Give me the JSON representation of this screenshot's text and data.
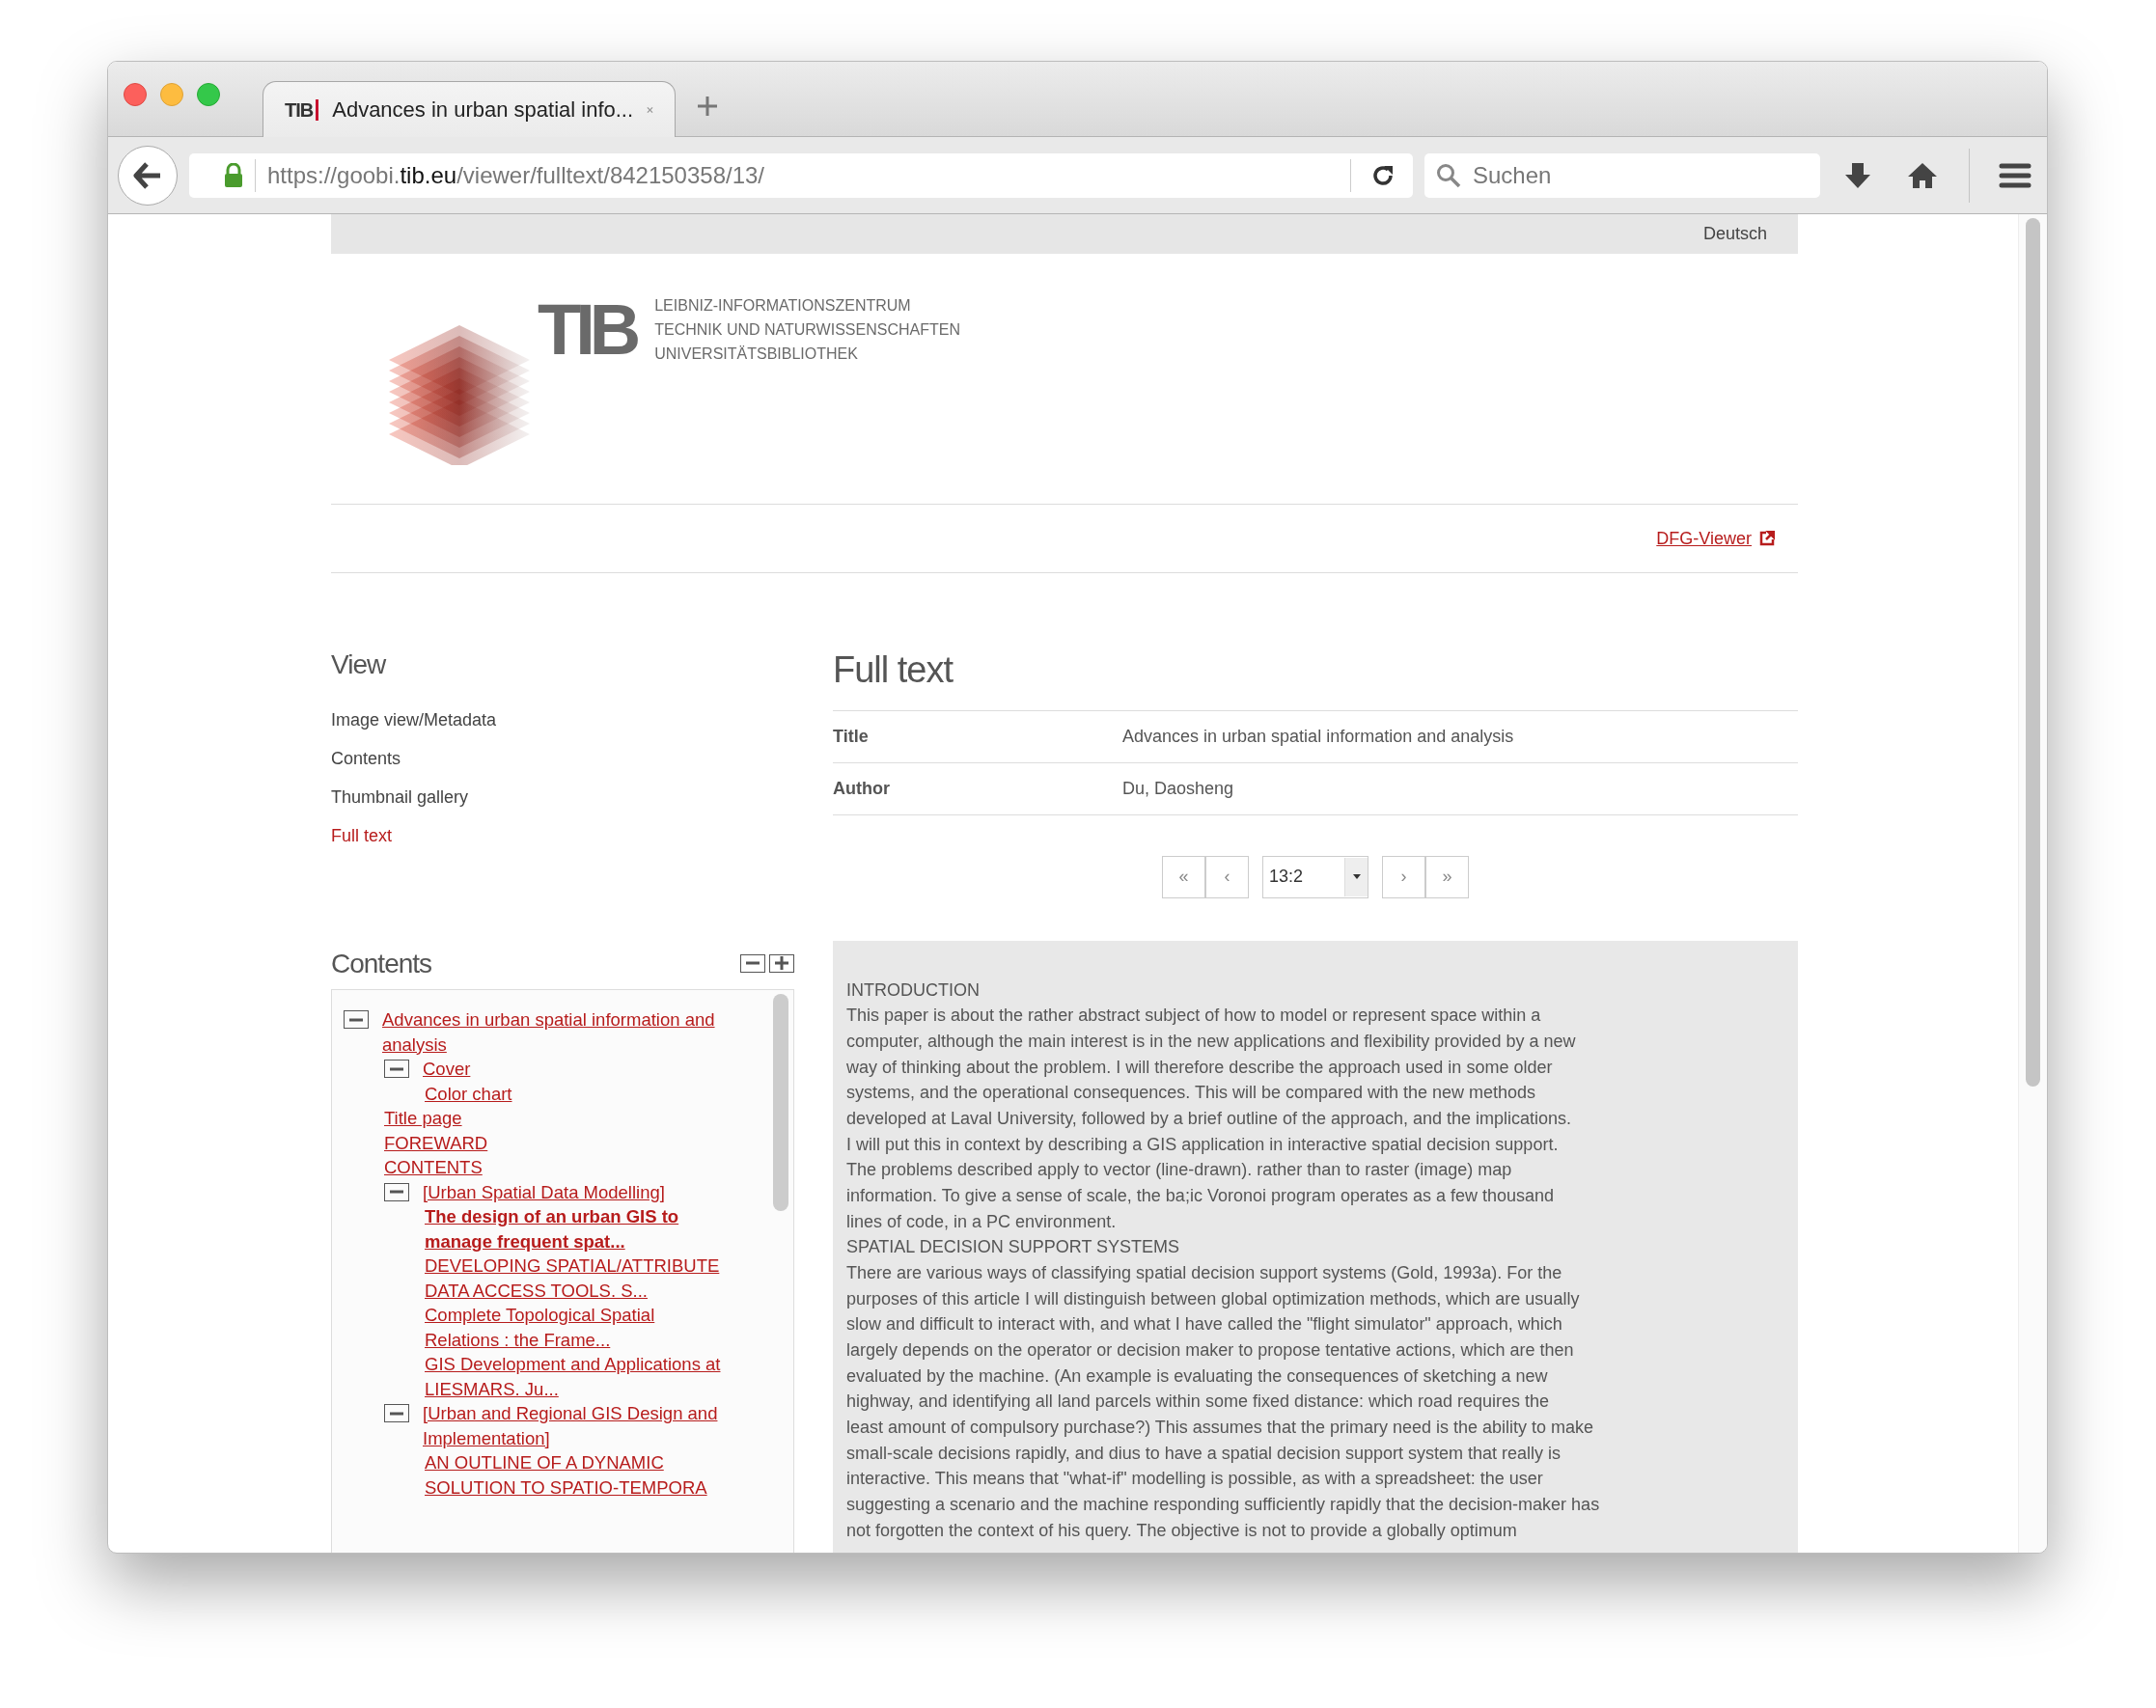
{
  "browser": {
    "tabs": [
      {
        "favicon": "TIB",
        "title": "Advances in urban spatial info...",
        "selected": true
      }
    ],
    "address": {
      "before": "https://goobi.",
      "domain": "tib.eu",
      "after": "/viewer/fulltext/842150358/13/"
    },
    "search": {
      "placeholder": "Suchen"
    }
  },
  "language": "Deutsch",
  "logo": {
    "abbr": "TIB",
    "lines": [
      "LEIBNIZ-INFORMATIONSZENTRUM",
      "TECHNIK UND NATURWISSENSCHAFTEN",
      "UNIVERSITÄTSBIBLIOTHEK"
    ]
  },
  "dfg_link": "DFG-Viewer",
  "view": {
    "heading": "View",
    "items": [
      {
        "label": "Image view/Metadata",
        "selected": false
      },
      {
        "label": "Contents",
        "selected": false
      },
      {
        "label": "Thumbnail gallery",
        "selected": false
      },
      {
        "label": "Full text",
        "selected": true
      }
    ]
  },
  "contents": {
    "heading": "Contents",
    "tree": [
      {
        "label": "Advances in urban spatial information and analysis",
        "selected": false,
        "expanded": true,
        "children": [
          {
            "label": "Cover",
            "selected": false,
            "expanded": true,
            "children": [
              {
                "label": "Color chart",
                "selected": false
              }
            ]
          },
          {
            "label": "Title page",
            "selected": false
          },
          {
            "label": "FOREWARD",
            "selected": false
          },
          {
            "label": "CONTENTS",
            "selected": false
          },
          {
            "label": "[Urban Spatial Data Modelling]",
            "selected": false,
            "expanded": true,
            "children": [
              {
                "label": "The design of an urban GIS to manage frequent spat...",
                "selected": true
              },
              {
                "label": "DEVELOPING SPATIAL/ATTRIBUTE DATA ACCESS TOOLS. S...",
                "selected": false
              },
              {
                "label": "Complete Topological Spatial Relations : the Frame...",
                "selected": false
              },
              {
                "label": "GIS Development and Applications at LIESMARS. Ju...",
                "selected": false
              }
            ]
          },
          {
            "label": "[Urban and Regional GIS Design and Implementation]",
            "selected": false,
            "expanded": true,
            "children": [
              {
                "label": "AN OUTLINE OF A DYNAMIC SOLUTION TO SPATIO-TEMPORA",
                "selected": false
              }
            ]
          }
        ]
      }
    ]
  },
  "fulltext": {
    "heading": "Full text",
    "metadata": [
      {
        "label": "Title",
        "value": "Advances in urban spatial information and analysis"
      },
      {
        "label": "Author",
        "value": "Du, Daosheng"
      }
    ],
    "pager": {
      "first": "«",
      "prev": "‹",
      "page": "13:2",
      "next": "›",
      "last": "»"
    },
    "lines": [
      "INTRODUCTION",
      "This paper is about the rather abstract subject of how to model or represent space within a",
      "computer, although the main interest is in the new applications and flexibility provided by a new",
      "way of thinking about the problem. I will therefore describe the approach used in some older",
      "systems, and the operational consequences. This will be compared with the new methods",
      "developed at Laval University, followed by a brief outline of the approach, and the implications.",
      "I will put this in context by describing a GIS application in interactive spatial decision support.",
      "The problems described apply to vector (line-drawn). rather than to raster (image) map",
      "information. To give a sense of scale, the ba;ic Voronoi program operates as a few thousand",
      "lines of code, in a PC environment.",
      "SPATIAL DECISION SUPPORT SYSTEMS",
      "There are various ways of classifying spatial decision support systems (Gold, 1993a). For the",
      "purposes of this article I will distinguish between global optimization methods, which are usually",
      "slow and difficult to interact with, and what I have called the \"flight simulator\" approach, which",
      "largely depends on the operator or decision maker to propose tentative actions, which are then",
      "evaluated by the machine. (An example is evaluating the consequences of sketching a new",
      "highway, and identifying all land parcels within some fixed distance: which road requires the",
      "least amount of compulsory purchase?) This assumes that the primary need is the ability to make",
      "small-scale decisions rapidly, and dius to have a spatial decision support system that really is",
      "interactive. This means that \"what-if\" modelling is possible, as with a spreadsheet: the user",
      "suggesting a scenario and the machine responding sufficiently rapidly that the decision-maker has",
      "not forgotten the context of his query. The objective is not to provide a globally optimum"
    ]
  }
}
